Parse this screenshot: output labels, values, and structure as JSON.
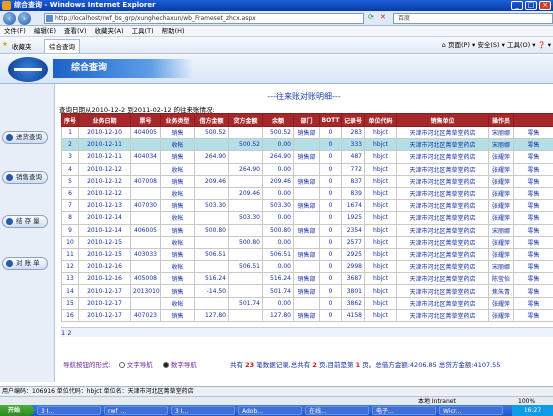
{
  "window": {
    "title": "综合查询 - Windows Internet Explorer"
  },
  "browser": {
    "address": "http://localhost/rwf_bs_grp/xunghechaxun/wb_Frameset_zhcx.aspx",
    "search_placeholder": "百度",
    "menu": [
      "文件(F)",
      "编辑(E)",
      "查看(V)",
      "收藏夹(A)",
      "工具(T)",
      "帮助(H)"
    ],
    "favorites_label": "收藏夹",
    "tab_label": "综合查询",
    "tools": [
      "页面(P) ▾",
      "安全(S) ▾",
      "工具(O) ▾",
      "❓ ▾"
    ]
  },
  "header": {
    "banner": "综合查询"
  },
  "sidebar": {
    "items": [
      {
        "label": "进货查询"
      },
      {
        "label": "销售查询"
      },
      {
        "label": "结 存 量"
      },
      {
        "label": "对 账 单"
      }
    ]
  },
  "report": {
    "title": "---往来账对账明细---",
    "date_info": "查询日期从2010-12-2 到2011-02-12 的往来账情况:",
    "columns": [
      "序号",
      "业务日期",
      "票号",
      "业务类型",
      "借方金额",
      "贷方金额",
      "余额",
      "部门",
      "BOTT",
      "记录号",
      "单位代码",
      "销售单位",
      "操作员",
      ""
    ],
    "rows": [
      [
        "1",
        "2010-12-10",
        "404005",
        "销售",
        "500.52",
        "",
        "500.52",
        "销售部",
        "0",
        "283",
        "hbjct",
        "天津市河北区菁草堂药店",
        "宋丽娜",
        "零售"
      ],
      [
        "2",
        "2010-12-11",
        "",
        "收帐",
        "",
        "500.52",
        "0.00",
        "",
        "0",
        "333",
        "hbjct",
        "天津市河北区菁草堂药店",
        "宋丽娜",
        "零售"
      ],
      [
        "3",
        "2010-12-11",
        "404034",
        "销售",
        "264.90",
        "",
        "264.90",
        "销售部",
        "0",
        "487",
        "hbjct",
        "天津市河北区菁草堂药店",
        "张耀萍",
        "零售"
      ],
      [
        "4",
        "2010-12-12",
        "",
        "收帐",
        "",
        "264.90",
        "0.00",
        "",
        "0",
        "772",
        "hbjct",
        "天津市河北区菁草堂药店",
        "张耀萍",
        "零售"
      ],
      [
        "5",
        "2010-12-12",
        "407008",
        "销售",
        "209.46",
        "",
        "209.46",
        "销售部",
        "0",
        "837",
        "hbjct",
        "天津市河北区菁草堂药店",
        "张耀萍",
        "零售"
      ],
      [
        "6",
        "2010-12-12",
        "",
        "收帐",
        "",
        "209.46",
        "0.00",
        "",
        "0",
        "839",
        "hbjct",
        "天津市河北区菁草堂药店",
        "张耀萍",
        "零售"
      ],
      [
        "7",
        "2010-12-13",
        "407030",
        "销售",
        "503.30",
        "",
        "503.30",
        "销售部",
        "0",
        "1674",
        "hbjct",
        "天津市河北区菁草堂药店",
        "张耀萍",
        "零售"
      ],
      [
        "8",
        "2010-12-14",
        "",
        "收帐",
        "",
        "503.30",
        "0.00",
        "",
        "0",
        "1925",
        "hbjct",
        "天津市河北区菁草堂药店",
        "张耀萍",
        "零售"
      ],
      [
        "9",
        "2010-12-14",
        "406005",
        "销售",
        "500.80",
        "",
        "500.80",
        "销售部",
        "0",
        "2354",
        "hbjct",
        "天津市河北区菁草堂药店",
        "宋丽娜",
        "零售"
      ],
      [
        "10",
        "2010-12-15",
        "",
        "收帐",
        "",
        "500.80",
        "0.00",
        "",
        "0",
        "2577",
        "hbjct",
        "天津市河北区菁草堂药店",
        "张耀萍",
        "零售"
      ],
      [
        "11",
        "2010-12-15",
        "403033",
        "销售",
        "506.51",
        "",
        "506.51",
        "销售部",
        "0",
        "2925",
        "hbjct",
        "天津市河北区菁草堂药店",
        "张耀萍",
        "零售"
      ],
      [
        "12",
        "2010-12-16",
        "",
        "收帐",
        "",
        "506.51",
        "0.00",
        "",
        "0",
        "2998",
        "hbjct",
        "天津市河北区菁草堂药店",
        "宋丽娜",
        "零售"
      ],
      [
        "13",
        "2010-12-16",
        "405008",
        "销售",
        "516.24",
        "",
        "516.24",
        "销售部",
        "0",
        "3687",
        "hbjct",
        "天津市河北区菁草堂药店",
        "陈莹怡",
        "零售"
      ],
      [
        "14",
        "2010-12-17",
        "2013010",
        "销售",
        "-14.50",
        "",
        "501.74",
        "销售部",
        "0",
        "3801",
        "hbjct",
        "天津市河北区菁草堂药店",
        "焦朱青",
        "零售"
      ],
      [
        "15",
        "2010-12-17",
        "",
        "收帐",
        "",
        "501.74",
        "0.00",
        "",
        "0",
        "3862",
        "hbjct",
        "天津市河北区菁草堂药店",
        "张耀萍",
        "零售"
      ],
      [
        "16",
        "2010-12-17",
        "407023",
        "销售",
        "127.80",
        "",
        "127.80",
        "销售部",
        "0",
        "4158",
        "hbjct",
        "天津市河北区菁草堂药店",
        "张耀萍",
        "零售"
      ]
    ],
    "selected_row": 1,
    "pages": "1 2",
    "nav_style_label": "导航按钮的形式:",
    "nav_options": [
      "文字导航",
      "数字导航"
    ],
    "summary": {
      "prefix": "共有",
      "records": "23",
      "mid1": "笔数据记录,总共有",
      "pages": "2",
      "mid2": "页,目前是第",
      "current": "1",
      "mid3": "页。总借方金额:4206.85 总贷方金额:4107.55"
    }
  },
  "status": "用户编码：106916 单位代码：hbjct 单位名：天津市河北区菁草堂药店",
  "ie_status": {
    "zone": "本地 Intranet",
    "zoom": "100%"
  },
  "taskbar": {
    "start": "开始",
    "tasks": [
      "3 I...",
      "rwf_...",
      "3 I...",
      "Adob...",
      "在线...",
      "电子...",
      "Wicr..."
    ],
    "clock": "16:27"
  }
}
